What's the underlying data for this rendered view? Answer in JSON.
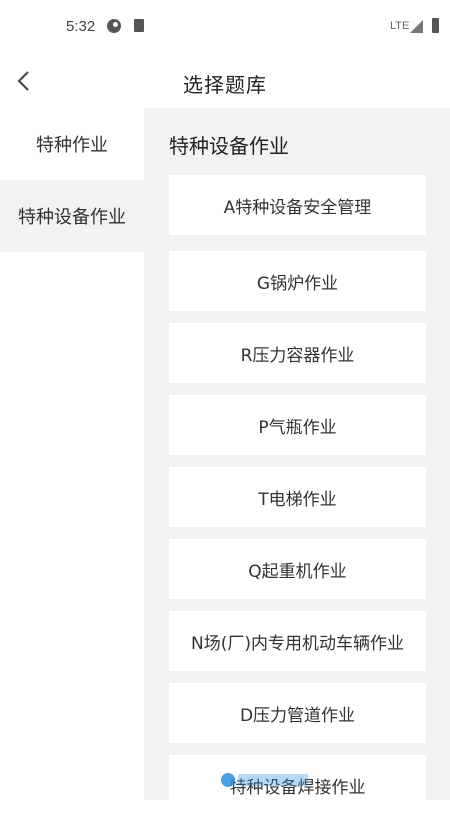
{
  "status_bar": {
    "time": "5:32",
    "network": "LTE"
  },
  "header": {
    "title": "选择题库"
  },
  "sidebar": {
    "items": [
      {
        "label": "特种作业",
        "active": false
      },
      {
        "label": "特种设备作业",
        "active": true
      }
    ]
  },
  "content": {
    "section_title": "特种设备作业",
    "cards": [
      "A特种设备安全管理",
      "G锅炉作业",
      "R压力容器作业",
      "P气瓶作业",
      "T电梯作业",
      "Q起重机作业",
      "N场(厂)内专用机动车辆作业",
      "D压力管道作业",
      "特种设备焊接作业"
    ]
  },
  "colors": {
    "panel_bg": "#f2f2f2",
    "card_bg": "#ffffff",
    "text": "#333333"
  }
}
